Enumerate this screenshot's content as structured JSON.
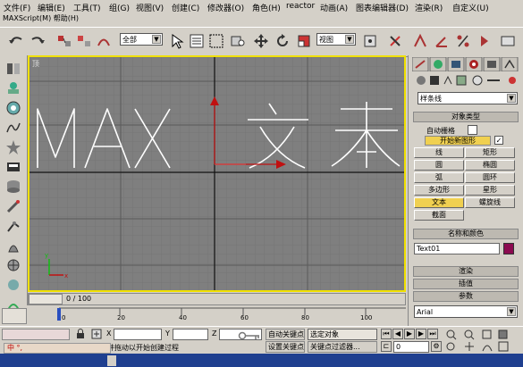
{
  "menu": [
    "文件(F)",
    "编辑(E)",
    "工具(T)",
    "组(G)",
    "视图(V)",
    "创建(C)",
    "修改器(O)",
    "角色(H)",
    "reactor",
    "动画(A)",
    "图表编辑器(D)",
    "渲染(R)",
    "自定义(U)"
  ],
  "subtitle": "MAXScript(M)   帮助(H)",
  "toolbar": {
    "selection_filter": "全部",
    "coord_system": "视图"
  },
  "viewport": {
    "label": "顶",
    "text_object": "MAX文本",
    "text_color": "#ffffff"
  },
  "command_panel": {
    "category": "样条线",
    "object_type_title": "对象类型",
    "auto_grid": "自动栅格",
    "start_new_shape": "开始新图形",
    "buttons": [
      "线",
      "矩形",
      "圆",
      "椭圆",
      "弧",
      "圆环",
      "多边形",
      "星形",
      "文本",
      "螺旋线",
      "截面"
    ],
    "active_button": "文本",
    "name_color_title": "名称和颜色",
    "name_value": "Text01",
    "object_color": "#8b0a50",
    "rollout_render": "渲染",
    "rollout_interp": "插值",
    "rollout_params": "参数",
    "font_value": "Arial"
  },
  "time_slider": {
    "label": "0 / 100"
  },
  "track": {
    "ticks": [
      "0",
      "20",
      "40",
      "60",
      "80",
      "100"
    ]
  },
  "status": {
    "x_label": "X",
    "y_label": "Y",
    "z_label": "Z",
    "autokey": "自动关键点",
    "setkey": "设置关键点",
    "selected_dropdown": "选定对象",
    "key_filter": "关键点过滤器...",
    "prompt": "单击并拖动以开始创建过程",
    "frame_value": "0",
    "ime_text": "中 °,"
  }
}
